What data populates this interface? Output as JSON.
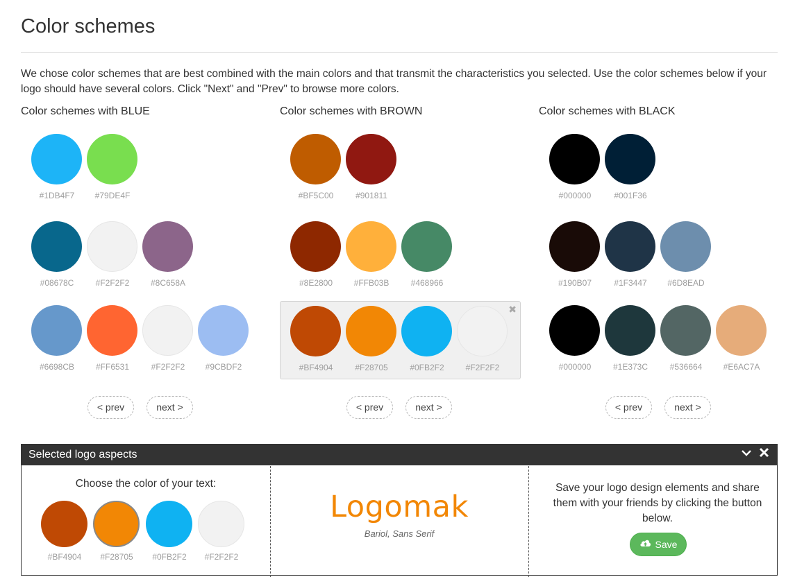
{
  "page": {
    "title": "Color schemes",
    "intro": "We chose color schemes that are best combined with the main colors and that transmit the characteristics you selected. Use the color schemes below if your logo should have several colors. Click \"Next\" and \"Prev\" to browse more colors."
  },
  "columns": [
    {
      "title": "Color schemes with BLUE",
      "prev_label": "< prev",
      "next_label": "next >",
      "schemes": [
        {
          "colors": [
            "#1DB4F7",
            "#79DE4F"
          ],
          "selected": false
        },
        {
          "colors": [
            "#08678C",
            "#F2F2F2",
            "#8C658A"
          ],
          "selected": false
        },
        {
          "colors": [
            "#6698CB",
            "#FF6531",
            "#F2F2F2",
            "#9CBDF2"
          ],
          "selected": false
        }
      ]
    },
    {
      "title": "Color schemes with BROWN",
      "prev_label": "< prev",
      "next_label": "next >",
      "schemes": [
        {
          "colors": [
            "#BF5C00",
            "#901811"
          ],
          "selected": false
        },
        {
          "colors": [
            "#8E2800",
            "#FFB03B",
            "#468966"
          ],
          "selected": false
        },
        {
          "colors": [
            "#BF4904",
            "#F28705",
            "#0FB2F2",
            "#F2F2F2"
          ],
          "selected": true
        }
      ]
    },
    {
      "title": "Color schemes with BLACK",
      "prev_label": "< prev",
      "next_label": "next >",
      "schemes": [
        {
          "colors": [
            "#000000",
            "#001F36"
          ],
          "selected": false
        },
        {
          "colors": [
            "#190B07",
            "#1F3447",
            "#6D8EAD"
          ],
          "selected": false
        },
        {
          "colors": [
            "#000000",
            "#1E373C",
            "#536664",
            "#E6AC7A"
          ],
          "selected": false
        }
      ]
    }
  ],
  "panel": {
    "title": "Selected logo aspects",
    "collapse_icon": "chevron-down-icon",
    "close_icon": "close-icon",
    "text_color": {
      "label": "Choose the color of your text:",
      "options": [
        "#BF4904",
        "#F28705",
        "#0FB2F2",
        "#F2F2F2"
      ],
      "selected": "#F28705"
    },
    "preview": {
      "logo_text": "Logomak",
      "font_caption": "Bariol, Sans Serif",
      "text_color": "#F28705"
    },
    "save": {
      "text": "Save your logo design elements and share them with your friends by clicking the button below.",
      "button_label": "Save",
      "button_icon": "cloud-upload-icon"
    }
  }
}
